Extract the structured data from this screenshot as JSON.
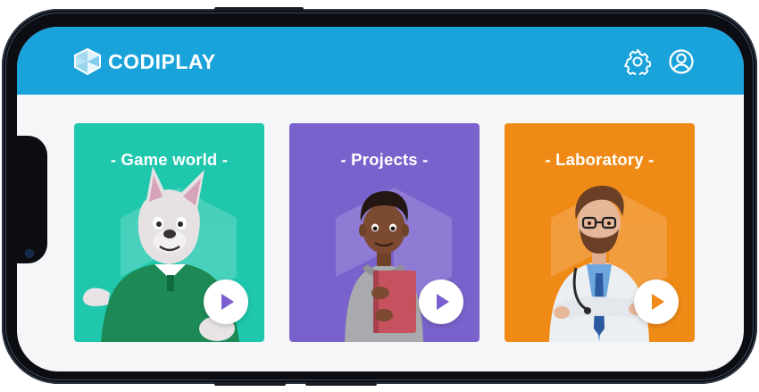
{
  "app": {
    "logo_text": "CODIPLAY"
  },
  "header": {
    "settings_icon": "gear-icon",
    "profile_icon": "user-circle-icon"
  },
  "cards": [
    {
      "title": "- Game world -",
      "color": "#1fc7ad",
      "character": "wolf mascot in green shirt"
    },
    {
      "title": "- Projects -",
      "color": "#7a62cc",
      "character": "boy holding red book"
    },
    {
      "title": "- Laboratory -",
      "color": "#f08a17",
      "character": "doctor in lab coat"
    }
  ],
  "colors": {
    "header": "#1aa3da",
    "background": "#f5f6f8",
    "play_icon": "#7b5fd0"
  }
}
